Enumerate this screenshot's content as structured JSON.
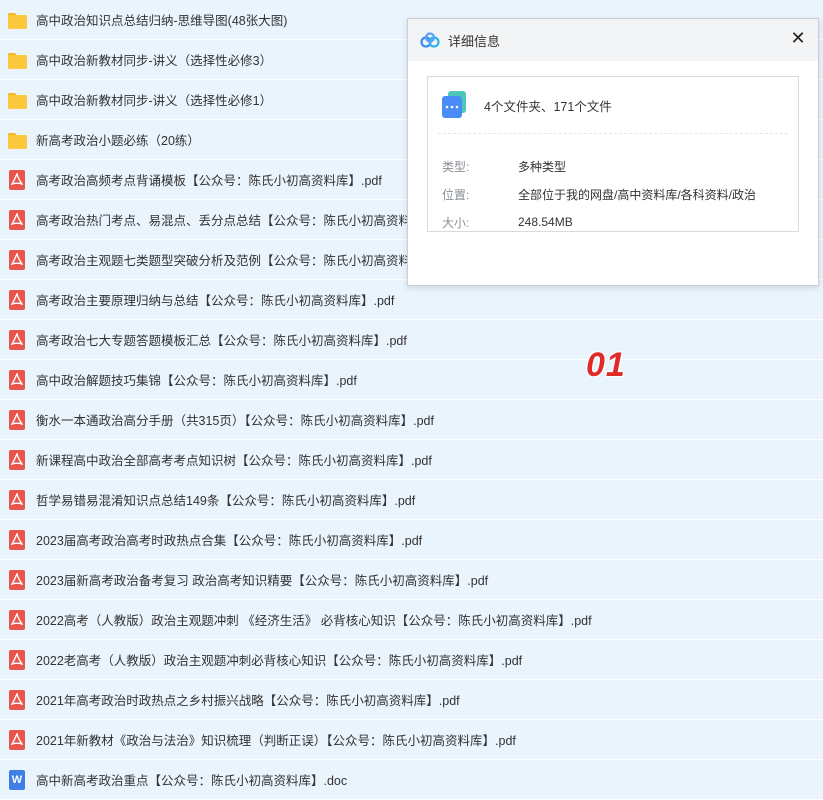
{
  "files": [
    {
      "type": "folder",
      "name": "高中政治知识点总结归纳-思维导图(48张大图)"
    },
    {
      "type": "folder",
      "name": "高中政治新教材同步-讲义（选择性必修3）"
    },
    {
      "type": "folder",
      "name": "高中政治新教材同步-讲义（选择性必修1）"
    },
    {
      "type": "folder",
      "name": "新高考政治小题必练（20练）"
    },
    {
      "type": "pdf",
      "name": "高考政治高频考点背诵模板【公众号：陈氏小初高资料库】.pdf"
    },
    {
      "type": "pdf",
      "name": "高考政治热门考点、易混点、丢分点总结【公众号：陈氏小初高资料库】.pdf"
    },
    {
      "type": "pdf",
      "name": "高考政治主观题七类题型突破分析及范例【公众号：陈氏小初高资料库】.pdf"
    },
    {
      "type": "pdf",
      "name": "高考政治主要原理归纳与总结【公众号：陈氏小初高资料库】.pdf"
    },
    {
      "type": "pdf",
      "name": "高考政治七大专题答题模板汇总【公众号：陈氏小初高资料库】.pdf"
    },
    {
      "type": "pdf",
      "name": "高中政治解题技巧集锦【公众号：陈氏小初高资料库】.pdf"
    },
    {
      "type": "pdf",
      "name": "衡水一本通政治高分手册（共315页）【公众号：陈氏小初高资料库】.pdf"
    },
    {
      "type": "pdf",
      "name": "新课程高中政治全部高考考点知识树【公众号：陈氏小初高资料库】.pdf"
    },
    {
      "type": "pdf",
      "name": "哲学易错易混淆知识点总结149条【公众号：陈氏小初高资料库】.pdf"
    },
    {
      "type": "pdf",
      "name": "2023届高考政治高考时政热点合集【公众号：陈氏小初高资料库】.pdf"
    },
    {
      "type": "pdf",
      "name": "2023届新高考政治备考复习 政治高考知识精要【公众号：陈氏小初高资料库】.pdf"
    },
    {
      "type": "pdf",
      "name": "2022高考（人教版）政治主观题冲刺 《经济生活》 必背核心知识【公众号：陈氏小初高资料库】.pdf"
    },
    {
      "type": "pdf",
      "name": "2022老高考（人教版）政治主观题冲刺必背核心知识【公众号：陈氏小初高资料库】.pdf"
    },
    {
      "type": "pdf",
      "name": "2021年高考政治时政热点之乡村振兴战略【公众号：陈氏小初高资料库】.pdf"
    },
    {
      "type": "pdf",
      "name": "2021年新教材《政治与法治》知识梳理（判断正误）【公众号：陈氏小初高资料库】.pdf"
    },
    {
      "type": "doc",
      "name": "高中新高考政治重点【公众号：陈氏小初高资料库】.doc"
    }
  ],
  "watermark": "01",
  "dialog": {
    "title": "详细信息",
    "close_icon": "close-icon",
    "summary": "4个文件夹、171个文件",
    "type_label": "类型:",
    "type_value": "多种类型",
    "location_label": "位置:",
    "location_value": "全部位于我的网盘/高中资料库/各科资料/政治",
    "size_label": "大小:",
    "size_value": "248.54MB"
  },
  "colors": {
    "list_bg": "#eaf4fd",
    "folder": "#fcc83c",
    "pdf": "#e9544b",
    "doc": "#3d7fe6",
    "watermark": "#e02a2a"
  }
}
